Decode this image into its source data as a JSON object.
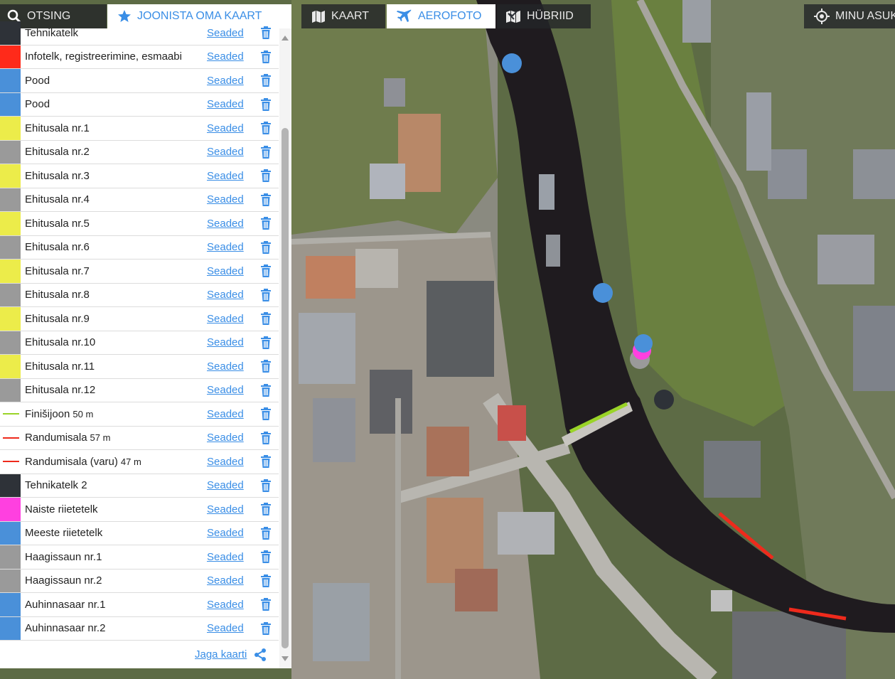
{
  "toolbar": {
    "search_label": "OTSING",
    "draw_label": "JOONISTA OMA KAART",
    "map_label": "KAART",
    "aerial_label": "AEROFOTO",
    "hybrid_label": "HÜBRIID",
    "locate_label": "MINU ASUKOHT",
    "active_tab": "AEROFOTO"
  },
  "colors": {
    "accent": "#3a8ee6",
    "dark": "#2e3238",
    "red": "#ff2a1a",
    "blue": "#4a90d9",
    "yellow": "#ecec4a",
    "gray": "#9a9a9a",
    "magenta": "#ff40e0",
    "green_line": "#9ad428",
    "red_line": "#ee2a1c"
  },
  "panel": {
    "settings_label": "Seaded",
    "share_label": "Jaga kaarti",
    "items": [
      {
        "name": "Tehnikatelk",
        "type": "area",
        "color": "#2e3238"
      },
      {
        "name": "Infotelk, registreerimine, esmaabi",
        "type": "area",
        "color": "#ff2a1a"
      },
      {
        "name": "Pood",
        "type": "area",
        "color": "#4a90d9"
      },
      {
        "name": "Pood",
        "type": "area",
        "color": "#4a90d9"
      },
      {
        "name": "Ehitusala nr.1",
        "type": "area",
        "color": "#ecec4a"
      },
      {
        "name": "Ehitusala nr.2",
        "type": "area",
        "color": "#9a9a9a"
      },
      {
        "name": "Ehitusala nr.3",
        "type": "area",
        "color": "#ecec4a"
      },
      {
        "name": "Ehitusala nr.4",
        "type": "area",
        "color": "#9a9a9a"
      },
      {
        "name": "Ehitusala nr.5",
        "type": "area",
        "color": "#ecec4a"
      },
      {
        "name": "Ehitusala nr.6",
        "type": "area",
        "color": "#9a9a9a"
      },
      {
        "name": "Ehitusala nr.7",
        "type": "area",
        "color": "#ecec4a"
      },
      {
        "name": "Ehitusala nr.8",
        "type": "area",
        "color": "#9a9a9a"
      },
      {
        "name": "Ehitusala nr.9",
        "type": "area",
        "color": "#ecec4a"
      },
      {
        "name": "Ehitusala nr.10",
        "type": "area",
        "color": "#9a9a9a"
      },
      {
        "name": "Ehitusala nr.11",
        "type": "area",
        "color": "#ecec4a"
      },
      {
        "name": "Ehitusala nr.12",
        "type": "area",
        "color": "#9a9a9a"
      },
      {
        "name": "Finišijoon",
        "type": "line",
        "length": "50 m",
        "color": "#9ad428"
      },
      {
        "name": "Randumisala",
        "type": "line",
        "length": "57 m",
        "color": "#ee2a1c"
      },
      {
        "name": "Randumisala (varu)",
        "type": "line",
        "length": "47 m",
        "color": "#ee2a1c"
      },
      {
        "name": "Tehnikatelk 2",
        "type": "area",
        "color": "#2e3238"
      },
      {
        "name": "Naiste riietetelk",
        "type": "area",
        "color": "#ff40e0"
      },
      {
        "name": "Meeste riietetelk",
        "type": "area",
        "color": "#4a90d9"
      },
      {
        "name": "Haagissaun nr.1",
        "type": "area",
        "color": "#9a9a9a"
      },
      {
        "name": "Haagissaun nr.2",
        "type": "area",
        "color": "#9a9a9a"
      },
      {
        "name": "Auhinnasaar nr.1",
        "type": "area",
        "color": "#4a90d9"
      },
      {
        "name": "Auhinnasaar nr.2",
        "type": "area",
        "color": "#4a90d9"
      }
    ]
  },
  "icons": {
    "search": "search-icon",
    "draw": "star-icon",
    "map": "map-icon",
    "aerial": "plane-icon",
    "hybrid": "hybrid-map-icon",
    "locate": "crosshair-icon",
    "delete": "trash-icon",
    "share": "share-icon"
  }
}
